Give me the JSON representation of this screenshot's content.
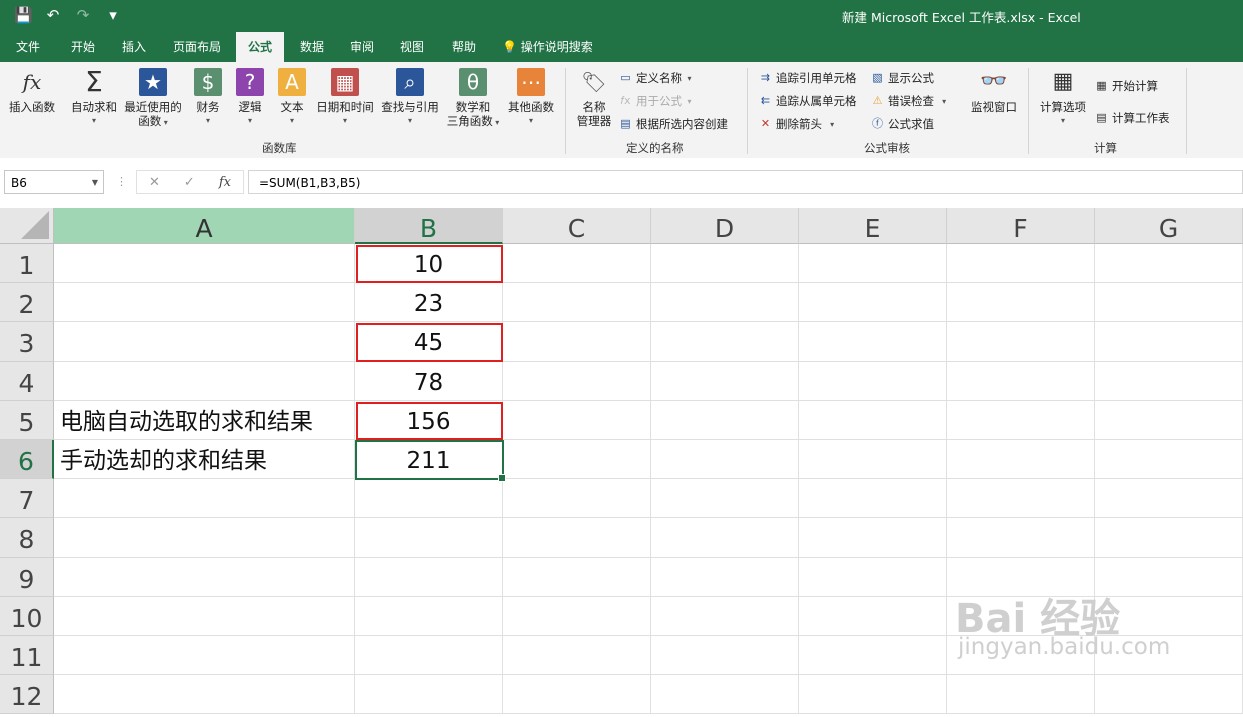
{
  "title_bar": {
    "quick_access": [
      "💾",
      "↶",
      "↷",
      "▾"
    ],
    "title": "新建 Microsoft Excel 工作表.xlsx  -  Excel"
  },
  "tabs": [
    "文件",
    "开始",
    "插入",
    "页面布局",
    "公式",
    "数据",
    "审阅",
    "视图",
    "帮助",
    "操作说明搜索"
  ],
  "active_tab": "公式",
  "ribbon": {
    "function_library": {
      "label": "函数库",
      "insert_function": "插入函数",
      "autosum": "自动求和",
      "recent_line1": "最近使用的",
      "recent_line2": "函数",
      "financial": "财务",
      "logical": "逻辑",
      "text": "文本",
      "datetime": "日期和时间",
      "lookup": "查找与引用",
      "math_line1": "数学和",
      "math_line2": "三角函数",
      "more": "其他函数"
    },
    "defined_names": {
      "label": "定义的名称",
      "name_manager_line1": "名称",
      "name_manager_line2": "管理器",
      "define_name": "定义名称",
      "use_in_formula": "用于公式",
      "create_from_selection": "根据所选内容创建"
    },
    "formula_auditing": {
      "label": "公式审核",
      "trace_precedents": "追踪引用单元格",
      "trace_dependents": "追踪从属单元格",
      "remove_arrows": "删除箭头",
      "show_formulas": "显示公式",
      "error_checking": "错误检查",
      "evaluate_formula": "公式求值",
      "watch_window": "监视窗口"
    },
    "calculation": {
      "label": "计算",
      "calc_options": "计算选项",
      "calc_now": "开始计算",
      "calc_sheet": "计算工作表"
    }
  },
  "formula_bar": {
    "name_box": "B6",
    "fx": "fx",
    "formula": "=SUM(B1,B3,B5)"
  },
  "sheet": {
    "columns": [
      "A",
      "B",
      "C",
      "D",
      "E",
      "F",
      "G"
    ],
    "rows": [
      "1",
      "2",
      "3",
      "4",
      "5",
      "6",
      "7",
      "8",
      "9",
      "10",
      "11",
      "12"
    ],
    "col_a": [
      "",
      "",
      "",
      "",
      "电脑自动选取的求和结果",
      "手动选却的求和结果",
      "",
      "",
      "",
      "",
      "",
      ""
    ],
    "col_b": [
      "10",
      "23",
      "45",
      "78",
      "156",
      "211",
      "",
      "",
      "",
      "",
      "",
      ""
    ]
  },
  "watermark": {
    "line1": "Bai 经验",
    "line2": "jingyan.baidu.com"
  },
  "colors": {
    "excel_green": "#217346",
    "highlight_red": "#e02020",
    "ribbon_bg": "#f3f3f3"
  }
}
